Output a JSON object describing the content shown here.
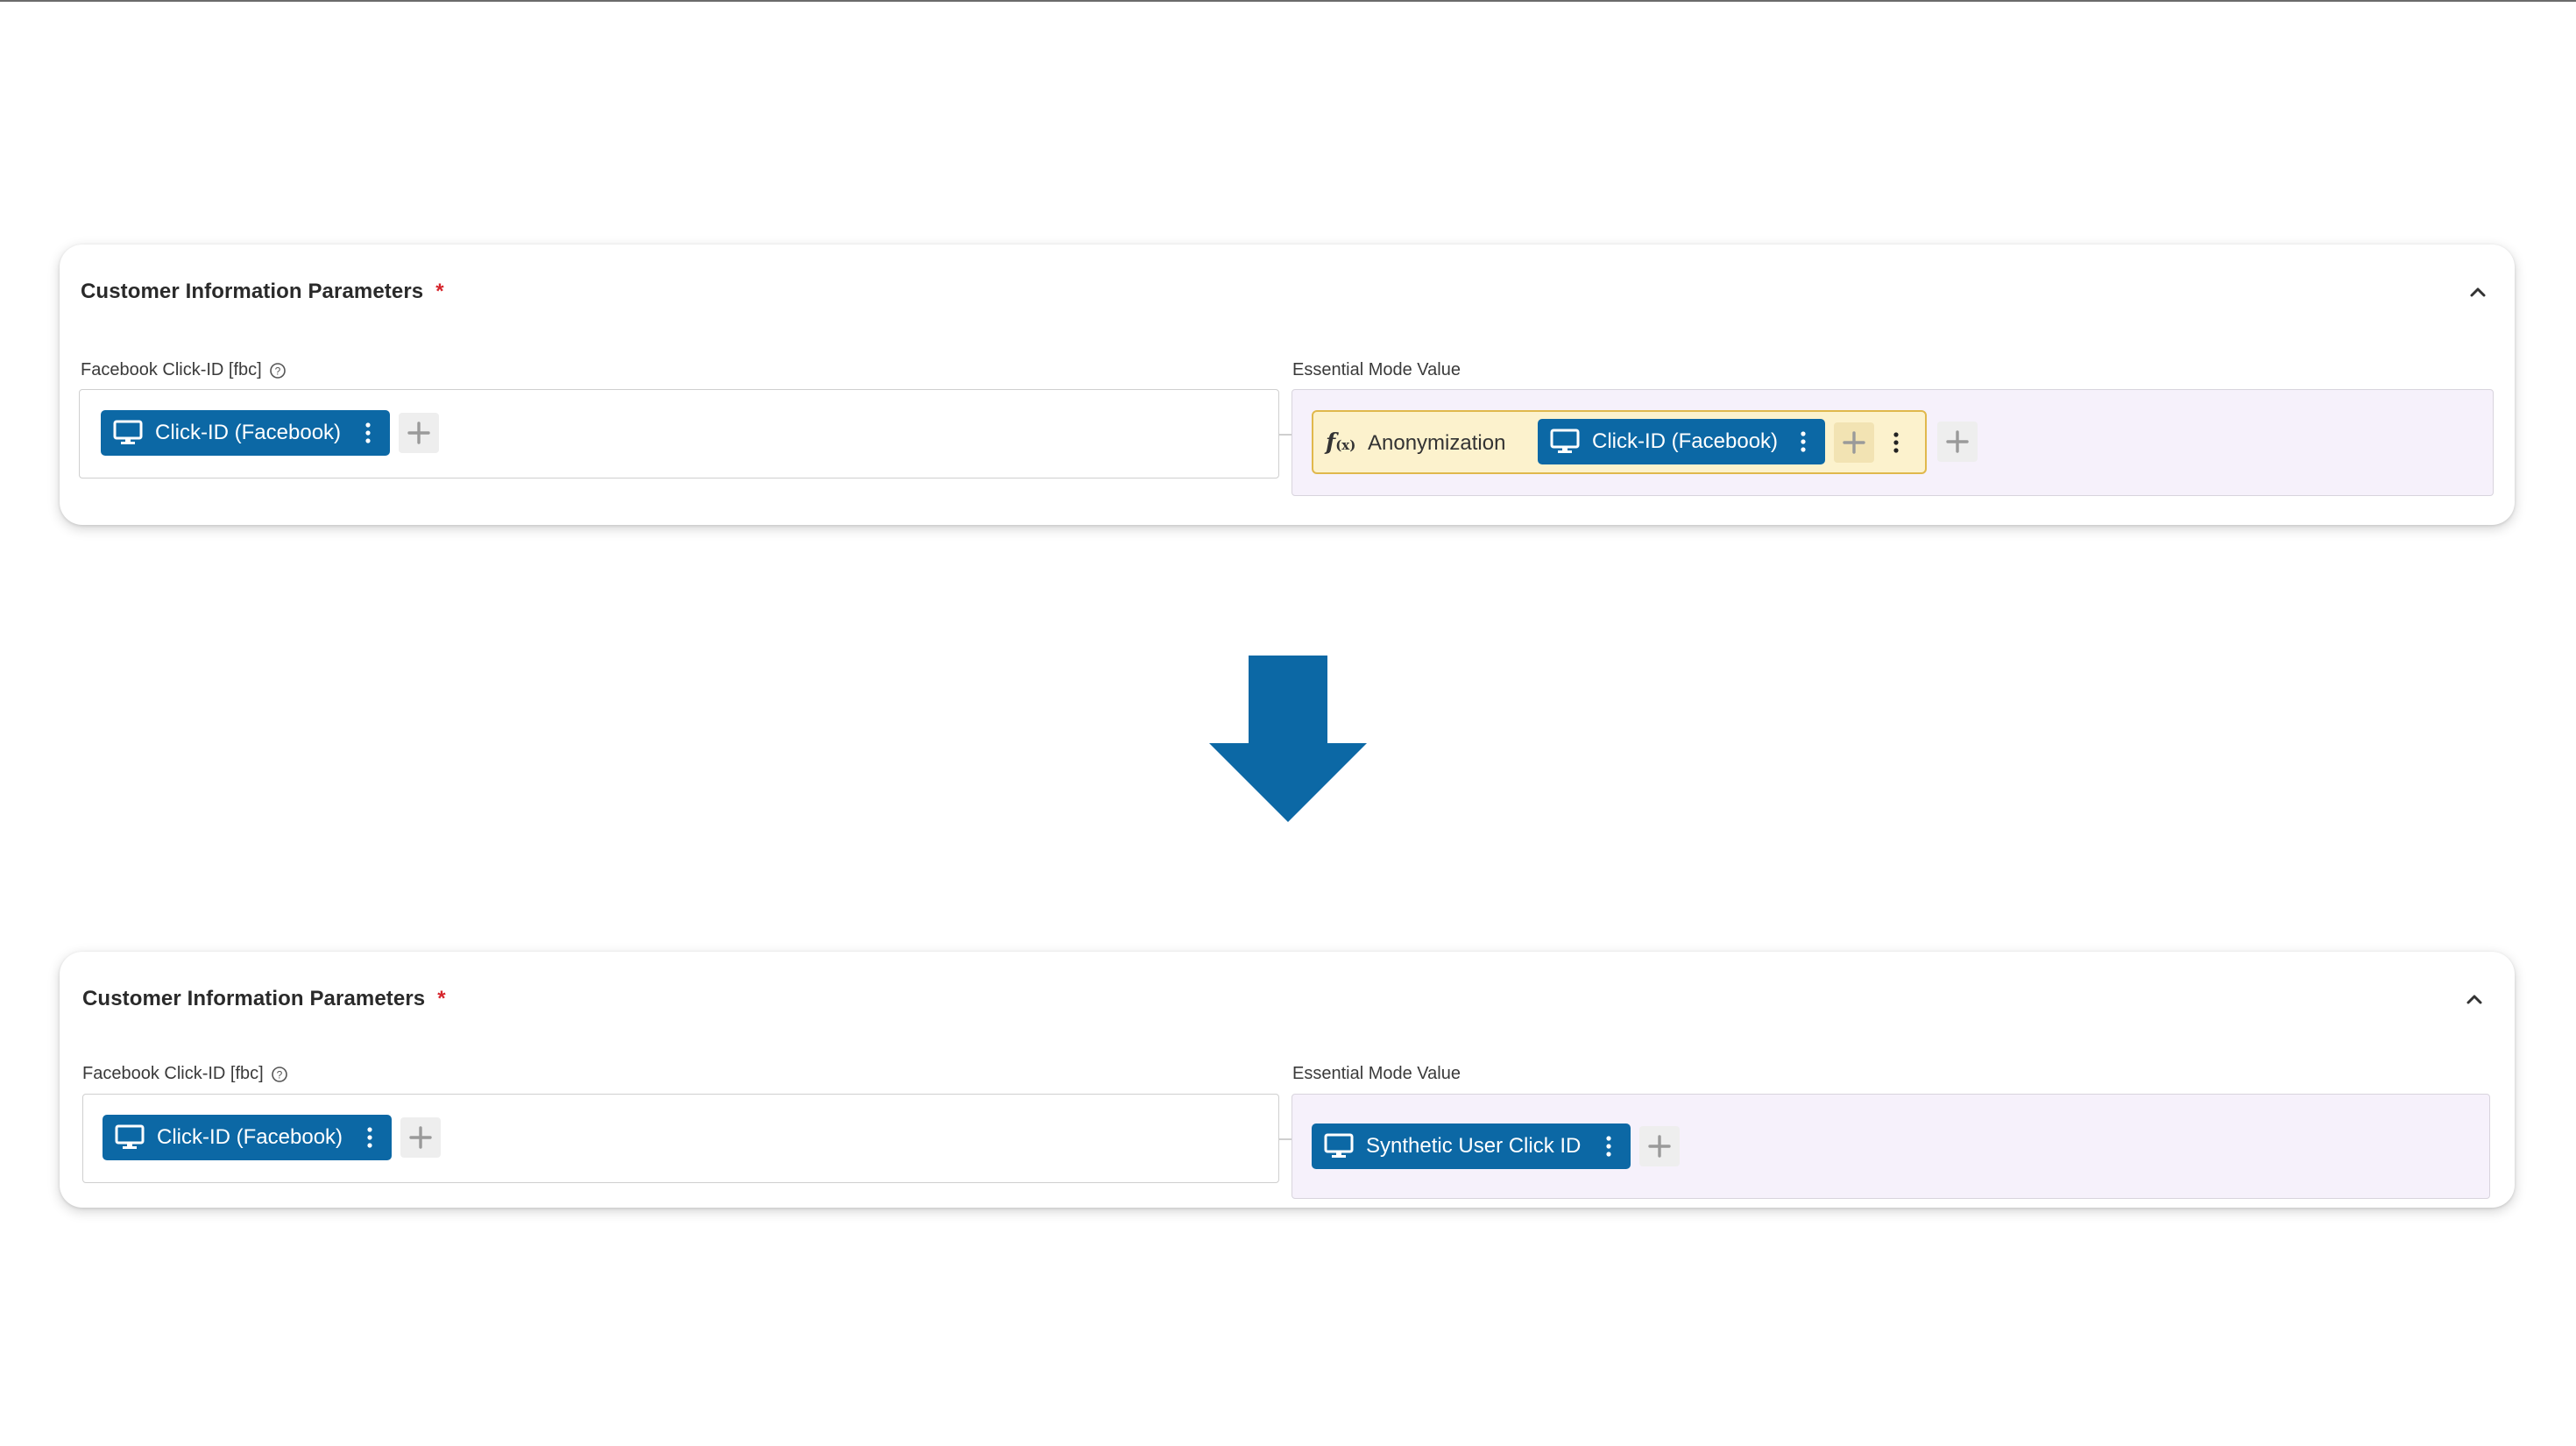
{
  "cards": [
    {
      "title": "Customer Information Parameters",
      "required_mark": "*",
      "left_field": {
        "label": "Facebook Click-ID [fbc]",
        "chip": "Click-ID (Facebook)"
      },
      "right_field": {
        "label": "Essential Mode Value",
        "function": "Anonymization",
        "chip": "Click-ID (Facebook)"
      }
    },
    {
      "title": "Customer Information Parameters",
      "required_mark": "*",
      "left_field": {
        "label": "Facebook Click-ID [fbc]",
        "chip": "Click-ID (Facebook)"
      },
      "right_field": {
        "label": "Essential Mode Value",
        "chip": "Synthetic User Click ID"
      }
    }
  ],
  "icons": {
    "variable": "monitor-icon",
    "menu": "kebab-menu-icon",
    "add": "plus-icon",
    "collapse": "chevron-up-icon",
    "info": "info-circle-icon",
    "function": "function-icon",
    "transition": "arrow-down-icon"
  },
  "colors": {
    "chip_blue": "#0c68a5",
    "required_red": "#d6252c",
    "function_bg": "#fcf2cd",
    "function_border": "#e0b84c",
    "essential_bg": "#f6f1fb",
    "arrow_blue": "#0c68a5"
  }
}
